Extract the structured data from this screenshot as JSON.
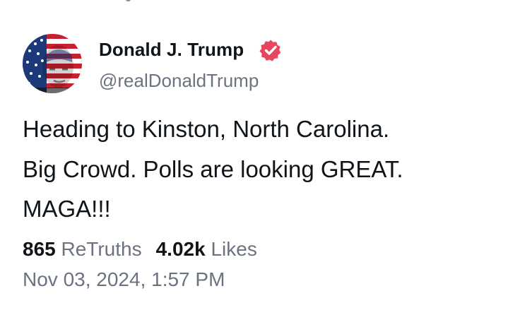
{
  "post": {
    "author": {
      "display_name": "Donald J. Trump",
      "handle": "@realDonaldTrump",
      "verified": true,
      "avatar_icon": "flag-portrait-avatar",
      "badge_color": "#e7475e"
    },
    "body_lines": [
      "Heading to Kinston, North Carolina.",
      "Big Crowd. Polls are looking GREAT.",
      "MAGA!!!"
    ],
    "stats": {
      "retruths_count": "865",
      "retruths_label": "ReTruths",
      "likes_count": "4.02k",
      "likes_label": "Likes"
    },
    "timestamp": "Nov 03, 2024, 1:57 PM"
  },
  "colors": {
    "text_primary": "#0f1419",
    "text_secondary": "#6b7280",
    "background": "#ffffff"
  }
}
